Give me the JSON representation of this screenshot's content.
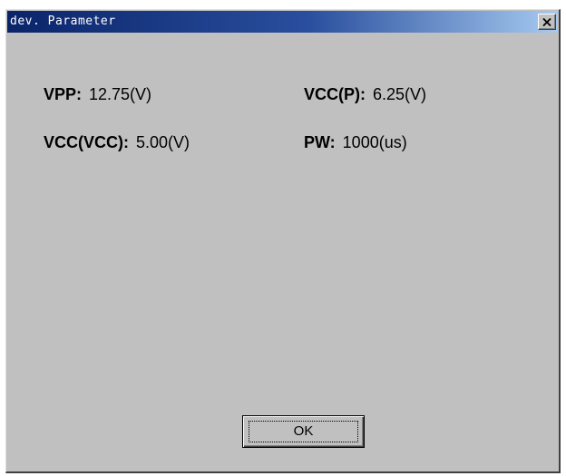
{
  "window": {
    "title": "dev. Parameter"
  },
  "title_bar": {
    "close_icon": "close-x-icon"
  },
  "parameters": {
    "vpp": {
      "label": "VPP:",
      "value": "12.75(V)"
    },
    "vcc_p": {
      "label": "VCC(P):",
      "value": "6.25(V)"
    },
    "vcc_vcc": {
      "label": "VCC(VCC):",
      "value": "5.00(V)"
    },
    "pw": {
      "label": "PW:",
      "value": "1000(us)"
    }
  },
  "buttons": {
    "ok_label": "OK"
  },
  "colors": {
    "dialog_face": "#c0c0c0",
    "titlebar_start": "#0a246a",
    "titlebar_end": "#a6caf0",
    "title_text": "#ffffff"
  }
}
